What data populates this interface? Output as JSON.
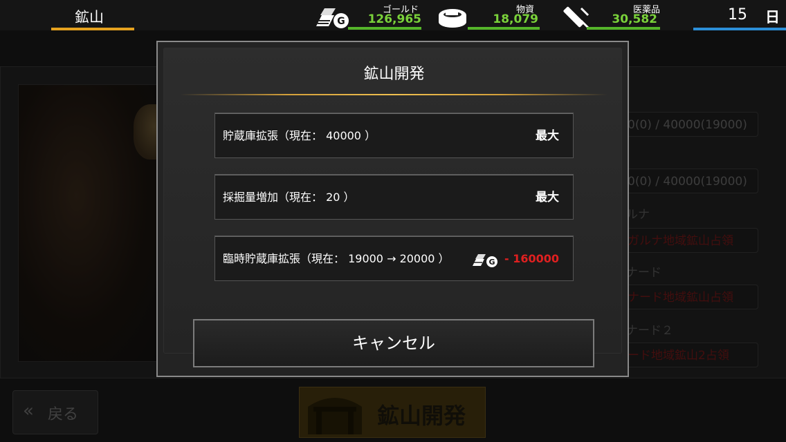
{
  "header": {
    "location": "鉱山",
    "resources": [
      {
        "icon": "gold-bars-icon",
        "label": "ゴールド",
        "value": "126,965"
      },
      {
        "icon": "supplies-can-icon",
        "label": "物資",
        "value": "18,079"
      },
      {
        "icon": "medicine-syringe-icon",
        "label": "医薬品",
        "value": "30,582"
      }
    ],
    "day_number": "15",
    "day_unit": "日"
  },
  "background": {
    "capacity_rows": [
      "0(0) / 40000(19000)",
      "0(0) / 40000(19000)"
    ],
    "region_names": [
      "ルナ",
      "ナード",
      "ナード２"
    ],
    "region_requirements": [
      "ガルナ地域鉱山占領",
      "ナード地域鉱山占領",
      "ード地域鉱山2占領"
    ],
    "back_button": "戻る",
    "develop_button": "鉱山開発"
  },
  "modal": {
    "title": "鉱山開発",
    "options": [
      {
        "label": "貯蔵庫拡張（現在： 40000 ）",
        "status": "最大"
      },
      {
        "label": "採掘量増加（現在： 20 ）",
        "status": "最大"
      },
      {
        "label": "臨時貯蔵庫拡張（現在： 19000 → 20000 ）",
        "cost": "- 160000",
        "cost_icon": "gold-bars-icon"
      }
    ],
    "cancel": "キャンセル"
  },
  "colors": {
    "gold_accent": "#e5a21f",
    "resource_green": "#7ad23a",
    "day_blue": "#2c8fd8",
    "cost_red": "#e02020"
  }
}
